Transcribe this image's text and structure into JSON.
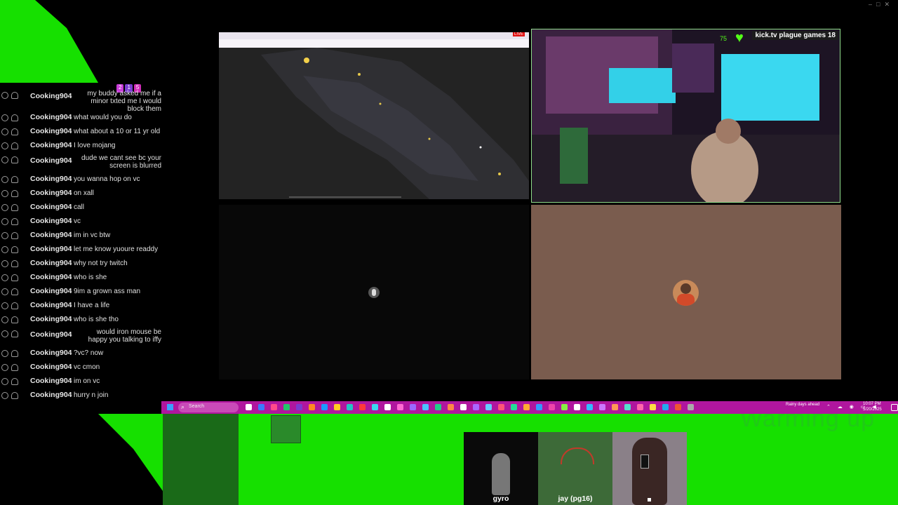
{
  "window": {
    "controls": [
      "minimize",
      "maximize",
      "close"
    ]
  },
  "chat": {
    "badges": [
      "2",
      "1",
      "5"
    ],
    "messages": [
      {
        "user": "Cooking904",
        "text": "my buddy asked me if a minor txted me I would block them"
      },
      {
        "user": "Cooking904",
        "text": "what would you do"
      },
      {
        "user": "Cooking904",
        "text": "what about a 10 or 11 yr old"
      },
      {
        "user": "Cooking904",
        "text": "I love mojang"
      },
      {
        "user": "Cooking904",
        "text": "dude we cant see bc your screen is blurred"
      },
      {
        "user": "Cooking904",
        "text": "you wanna hop on vc"
      },
      {
        "user": "Cooking904",
        "text": "on xall"
      },
      {
        "user": "Cooking904",
        "text": "call"
      },
      {
        "user": "Cooking904",
        "text": "vc"
      },
      {
        "user": "Cooking904",
        "text": "im in vc btw"
      },
      {
        "user": "Cooking904",
        "text": "let me know yuoure readdy"
      },
      {
        "user": "Cooking904",
        "text": "why not try twitch"
      },
      {
        "user": "Cooking904",
        "text": "who is she"
      },
      {
        "user": "Cooking904",
        "text": "9im a grown ass man"
      },
      {
        "user": "Cooking904",
        "text": "I have a life"
      },
      {
        "user": "Cooking904",
        "text": "who is she tho"
      },
      {
        "user": "Cooking904",
        "text": "would iron mouse be happy you talking to iffy"
      },
      {
        "user": "Cooking904",
        "text": "?vc? now"
      },
      {
        "user": "Cooking904",
        "text": "vc cmon"
      },
      {
        "user": "Cooking904",
        "text": "im on vc"
      },
      {
        "user": "Cooking904",
        "text": "hurry n join"
      }
    ]
  },
  "stream_overlay": {
    "live_badge": "LIVE",
    "kick_banner": "kick.tv plague games 18",
    "heart_count": "75"
  },
  "taskbar": {
    "search_placeholder": "Search",
    "weather": "Rainy days ahead",
    "time": "10:07 PM",
    "date": "5/20/2025"
  },
  "overlay_text": {
    "warming_up": "Warming up"
  },
  "cams": [
    {
      "label": "gyro"
    },
    {
      "label": "jay (pg16)"
    },
    {
      "label": ""
    }
  ],
  "colors": {
    "green_screen": "#16e000",
    "taskbar": "#b0169e",
    "profile_pane": "#7a5c4e",
    "cam_border": "#8fdc8a"
  }
}
